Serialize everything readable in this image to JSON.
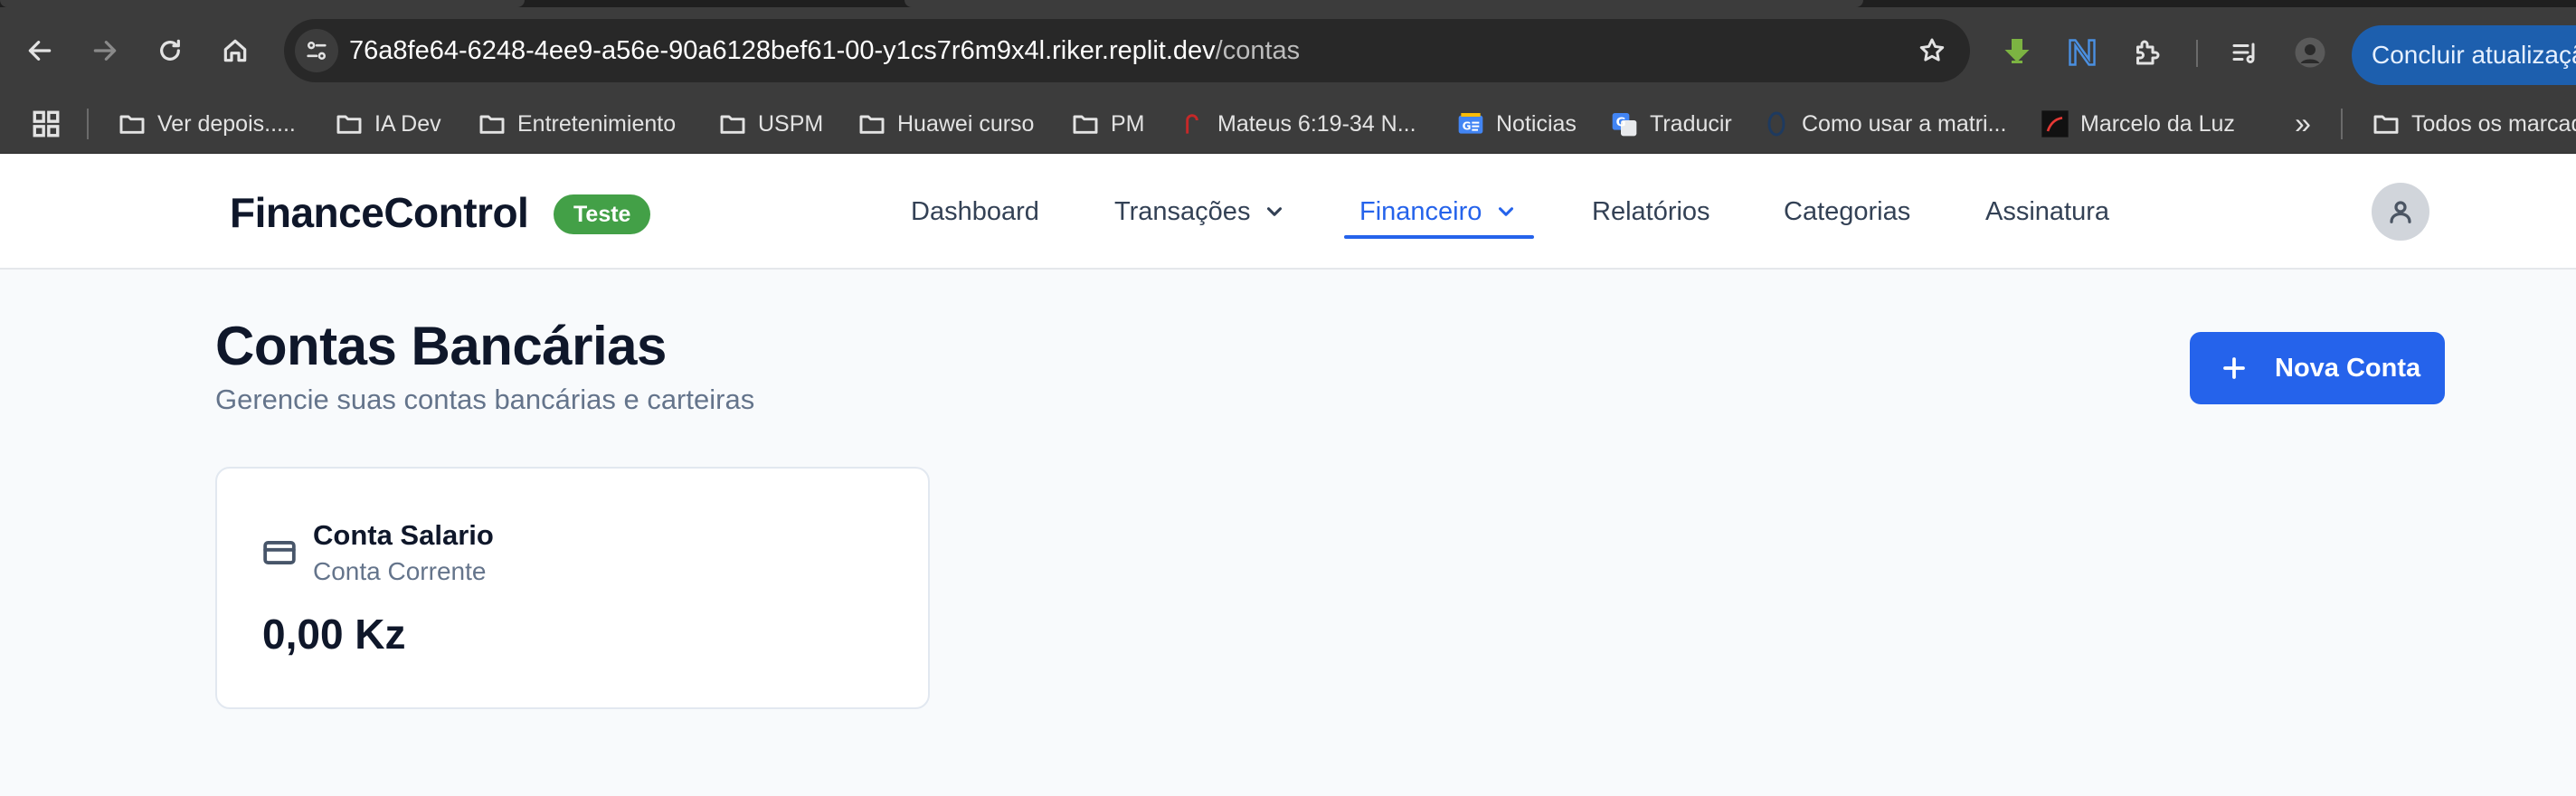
{
  "browser": {
    "url_host": "76a8fe64-6248-4ee9-a56e-90a6128bef61-00-y1cs7r6m9x4l.riker.replit.dev",
    "url_path": "/contas",
    "update_label": "Concluir atualização",
    "bookmarks": [
      {
        "label": "Ver depois.....",
        "icon": "folder-icon"
      },
      {
        "label": "IA Dev",
        "icon": "folder-icon"
      },
      {
        "label": "Entretenimiento",
        "icon": "folder-icon"
      },
      {
        "label": "USPM",
        "icon": "folder-icon"
      },
      {
        "label": "Huawei curso",
        "icon": "folder-icon"
      },
      {
        "label": "PM",
        "icon": "folder-icon"
      },
      {
        "label": "Mateus 6:19-34 N...",
        "icon": "bible-site-icon"
      },
      {
        "label": "Noticias",
        "icon": "google-news-icon"
      },
      {
        "label": "Traducir",
        "icon": "google-translate-icon"
      },
      {
        "label": "Como usar a matri...",
        "icon": "site-icon"
      },
      {
        "label": "Marcelo da Luz",
        "icon": "site-icon"
      },
      {
        "label": "Todos os marcadores",
        "icon": "folder-icon"
      }
    ]
  },
  "app": {
    "brand": "FinanceControl",
    "badge": "Teste",
    "nav": [
      {
        "label": "Dashboard",
        "has_dropdown": false,
        "active": false
      },
      {
        "label": "Transações",
        "has_dropdown": true,
        "active": false
      },
      {
        "label": "Financeiro",
        "has_dropdown": true,
        "active": true
      },
      {
        "label": "Relatórios",
        "has_dropdown": false,
        "active": false
      },
      {
        "label": "Categorias",
        "has_dropdown": false,
        "active": false
      },
      {
        "label": "Assinatura",
        "has_dropdown": false,
        "active": false
      }
    ]
  },
  "page": {
    "title": "Contas Bancárias",
    "subtitle": "Gerencie suas contas bancárias e carteiras",
    "new_account_label": "Nova Conta"
  },
  "accounts": [
    {
      "name": "Conta Salario",
      "type": "Conta Corrente",
      "balance": "0,00 Kz",
      "icon": "credit-card-icon"
    }
  ],
  "colors": {
    "accent": "#2563eb",
    "badge": "#43a047",
    "browser_chrome": "#3c3c3c",
    "page_background": "#f8fafc"
  }
}
